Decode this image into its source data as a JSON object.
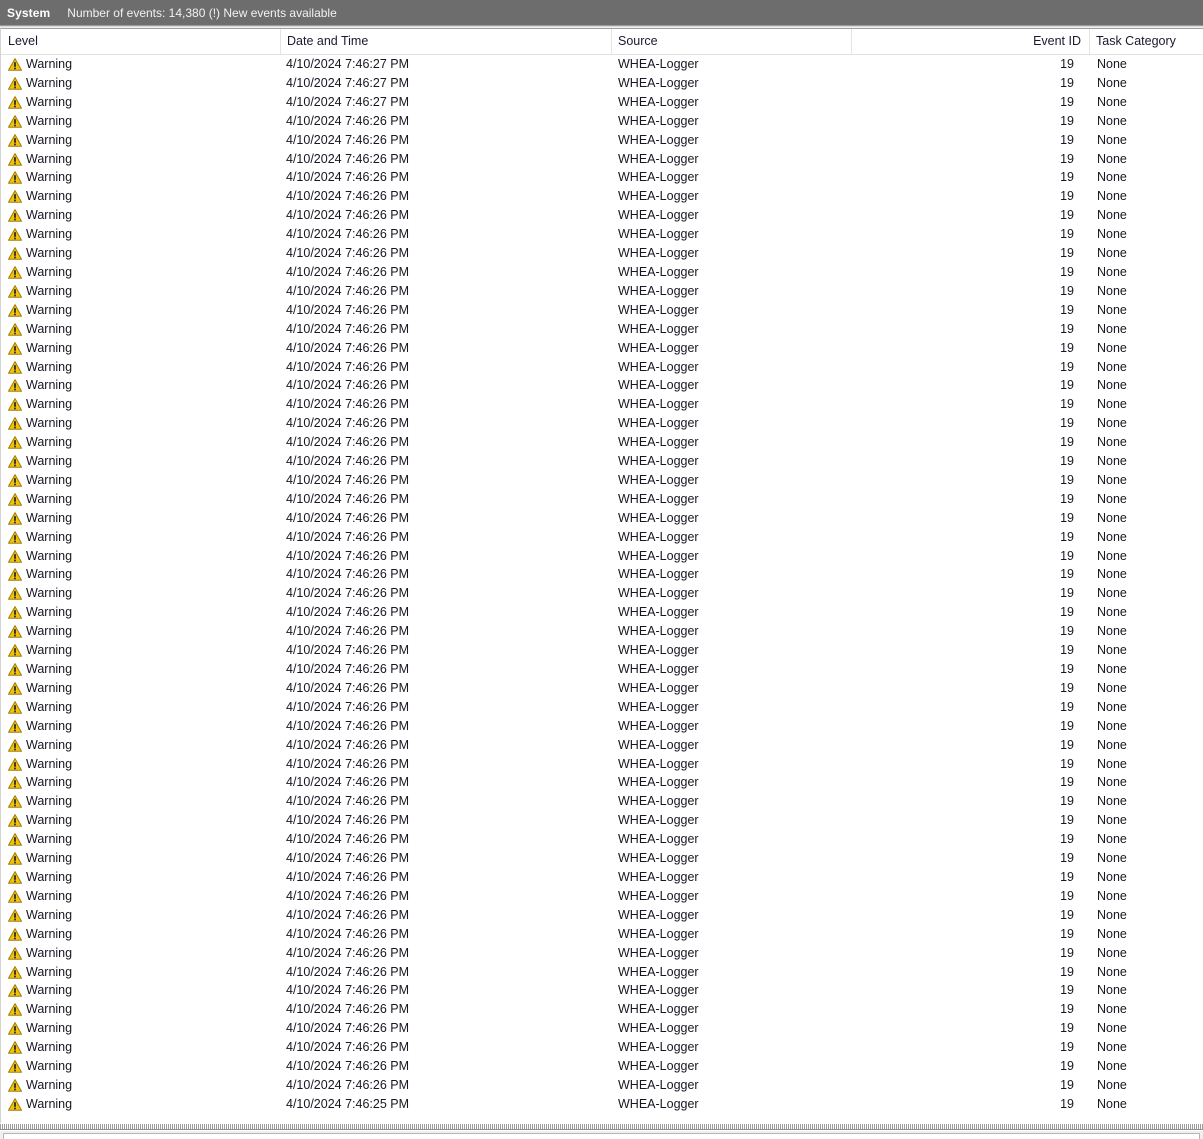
{
  "window": {
    "log_name": "System",
    "events_summary": "Number of events: 14,380 (!) New events available",
    "header_bg": "#6d6d6d"
  },
  "columns": [
    {
      "key": "level",
      "label": "Level",
      "align": "left"
    },
    {
      "key": "date",
      "label": "Date and Time",
      "align": "left"
    },
    {
      "key": "source",
      "label": "Source",
      "align": "left"
    },
    {
      "key": "eid",
      "label": "Event ID",
      "align": "right"
    },
    {
      "key": "task",
      "label": "Task Category",
      "align": "left"
    }
  ],
  "icons": {
    "warning": "warning-triangle-icon",
    "warning_fill": "#f2c209",
    "warning_stroke": "#a07e06",
    "warning_mark": "#2b2b2b"
  },
  "rows": [
    {
      "level": "Warning",
      "date": "4/10/2024 7:46:27 PM",
      "source": "WHEA-Logger",
      "eid": "19",
      "task": "None"
    },
    {
      "level": "Warning",
      "date": "4/10/2024 7:46:27 PM",
      "source": "WHEA-Logger",
      "eid": "19",
      "task": "None"
    },
    {
      "level": "Warning",
      "date": "4/10/2024 7:46:27 PM",
      "source": "WHEA-Logger",
      "eid": "19",
      "task": "None"
    },
    {
      "level": "Warning",
      "date": "4/10/2024 7:46:26 PM",
      "source": "WHEA-Logger",
      "eid": "19",
      "task": "None"
    },
    {
      "level": "Warning",
      "date": "4/10/2024 7:46:26 PM",
      "source": "WHEA-Logger",
      "eid": "19",
      "task": "None"
    },
    {
      "level": "Warning",
      "date": "4/10/2024 7:46:26 PM",
      "source": "WHEA-Logger",
      "eid": "19",
      "task": "None"
    },
    {
      "level": "Warning",
      "date": "4/10/2024 7:46:26 PM",
      "source": "WHEA-Logger",
      "eid": "19",
      "task": "None"
    },
    {
      "level": "Warning",
      "date": "4/10/2024 7:46:26 PM",
      "source": "WHEA-Logger",
      "eid": "19",
      "task": "None"
    },
    {
      "level": "Warning",
      "date": "4/10/2024 7:46:26 PM",
      "source": "WHEA-Logger",
      "eid": "19",
      "task": "None"
    },
    {
      "level": "Warning",
      "date": "4/10/2024 7:46:26 PM",
      "source": "WHEA-Logger",
      "eid": "19",
      "task": "None"
    },
    {
      "level": "Warning",
      "date": "4/10/2024 7:46:26 PM",
      "source": "WHEA-Logger",
      "eid": "19",
      "task": "None"
    },
    {
      "level": "Warning",
      "date": "4/10/2024 7:46:26 PM",
      "source": "WHEA-Logger",
      "eid": "19",
      "task": "None"
    },
    {
      "level": "Warning",
      "date": "4/10/2024 7:46:26 PM",
      "source": "WHEA-Logger",
      "eid": "19",
      "task": "None"
    },
    {
      "level": "Warning",
      "date": "4/10/2024 7:46:26 PM",
      "source": "WHEA-Logger",
      "eid": "19",
      "task": "None"
    },
    {
      "level": "Warning",
      "date": "4/10/2024 7:46:26 PM",
      "source": "WHEA-Logger",
      "eid": "19",
      "task": "None"
    },
    {
      "level": "Warning",
      "date": "4/10/2024 7:46:26 PM",
      "source": "WHEA-Logger",
      "eid": "19",
      "task": "None"
    },
    {
      "level": "Warning",
      "date": "4/10/2024 7:46:26 PM",
      "source": "WHEA-Logger",
      "eid": "19",
      "task": "None"
    },
    {
      "level": "Warning",
      "date": "4/10/2024 7:46:26 PM",
      "source": "WHEA-Logger",
      "eid": "19",
      "task": "None"
    },
    {
      "level": "Warning",
      "date": "4/10/2024 7:46:26 PM",
      "source": "WHEA-Logger",
      "eid": "19",
      "task": "None"
    },
    {
      "level": "Warning",
      "date": "4/10/2024 7:46:26 PM",
      "source": "WHEA-Logger",
      "eid": "19",
      "task": "None"
    },
    {
      "level": "Warning",
      "date": "4/10/2024 7:46:26 PM",
      "source": "WHEA-Logger",
      "eid": "19",
      "task": "None"
    },
    {
      "level": "Warning",
      "date": "4/10/2024 7:46:26 PM",
      "source": "WHEA-Logger",
      "eid": "19",
      "task": "None"
    },
    {
      "level": "Warning",
      "date": "4/10/2024 7:46:26 PM",
      "source": "WHEA-Logger",
      "eid": "19",
      "task": "None"
    },
    {
      "level": "Warning",
      "date": "4/10/2024 7:46:26 PM",
      "source": "WHEA-Logger",
      "eid": "19",
      "task": "None"
    },
    {
      "level": "Warning",
      "date": "4/10/2024 7:46:26 PM",
      "source": "WHEA-Logger",
      "eid": "19",
      "task": "None"
    },
    {
      "level": "Warning",
      "date": "4/10/2024 7:46:26 PM",
      "source": "WHEA-Logger",
      "eid": "19",
      "task": "None"
    },
    {
      "level": "Warning",
      "date": "4/10/2024 7:46:26 PM",
      "source": "WHEA-Logger",
      "eid": "19",
      "task": "None"
    },
    {
      "level": "Warning",
      "date": "4/10/2024 7:46:26 PM",
      "source": "WHEA-Logger",
      "eid": "19",
      "task": "None"
    },
    {
      "level": "Warning",
      "date": "4/10/2024 7:46:26 PM",
      "source": "WHEA-Logger",
      "eid": "19",
      "task": "None"
    },
    {
      "level": "Warning",
      "date": "4/10/2024 7:46:26 PM",
      "source": "WHEA-Logger",
      "eid": "19",
      "task": "None"
    },
    {
      "level": "Warning",
      "date": "4/10/2024 7:46:26 PM",
      "source": "WHEA-Logger",
      "eid": "19",
      "task": "None"
    },
    {
      "level": "Warning",
      "date": "4/10/2024 7:46:26 PM",
      "source": "WHEA-Logger",
      "eid": "19",
      "task": "None"
    },
    {
      "level": "Warning",
      "date": "4/10/2024 7:46:26 PM",
      "source": "WHEA-Logger",
      "eid": "19",
      "task": "None"
    },
    {
      "level": "Warning",
      "date": "4/10/2024 7:46:26 PM",
      "source": "WHEA-Logger",
      "eid": "19",
      "task": "None"
    },
    {
      "level": "Warning",
      "date": "4/10/2024 7:46:26 PM",
      "source": "WHEA-Logger",
      "eid": "19",
      "task": "None"
    },
    {
      "level": "Warning",
      "date": "4/10/2024 7:46:26 PM",
      "source": "WHEA-Logger",
      "eid": "19",
      "task": "None"
    },
    {
      "level": "Warning",
      "date": "4/10/2024 7:46:26 PM",
      "source": "WHEA-Logger",
      "eid": "19",
      "task": "None"
    },
    {
      "level": "Warning",
      "date": "4/10/2024 7:46:26 PM",
      "source": "WHEA-Logger",
      "eid": "19",
      "task": "None"
    },
    {
      "level": "Warning",
      "date": "4/10/2024 7:46:26 PM",
      "source": "WHEA-Logger",
      "eid": "19",
      "task": "None"
    },
    {
      "level": "Warning",
      "date": "4/10/2024 7:46:26 PM",
      "source": "WHEA-Logger",
      "eid": "19",
      "task": "None"
    },
    {
      "level": "Warning",
      "date": "4/10/2024 7:46:26 PM",
      "source": "WHEA-Logger",
      "eid": "19",
      "task": "None"
    },
    {
      "level": "Warning",
      "date": "4/10/2024 7:46:26 PM",
      "source": "WHEA-Logger",
      "eid": "19",
      "task": "None"
    },
    {
      "level": "Warning",
      "date": "4/10/2024 7:46:26 PM",
      "source": "WHEA-Logger",
      "eid": "19",
      "task": "None"
    },
    {
      "level": "Warning",
      "date": "4/10/2024 7:46:26 PM",
      "source": "WHEA-Logger",
      "eid": "19",
      "task": "None"
    },
    {
      "level": "Warning",
      "date": "4/10/2024 7:46:26 PM",
      "source": "WHEA-Logger",
      "eid": "19",
      "task": "None"
    },
    {
      "level": "Warning",
      "date": "4/10/2024 7:46:26 PM",
      "source": "WHEA-Logger",
      "eid": "19",
      "task": "None"
    },
    {
      "level": "Warning",
      "date": "4/10/2024 7:46:26 PM",
      "source": "WHEA-Logger",
      "eid": "19",
      "task": "None"
    },
    {
      "level": "Warning",
      "date": "4/10/2024 7:46:26 PM",
      "source": "WHEA-Logger",
      "eid": "19",
      "task": "None"
    },
    {
      "level": "Warning",
      "date": "4/10/2024 7:46:26 PM",
      "source": "WHEA-Logger",
      "eid": "19",
      "task": "None"
    },
    {
      "level": "Warning",
      "date": "4/10/2024 7:46:26 PM",
      "source": "WHEA-Logger",
      "eid": "19",
      "task": "None"
    },
    {
      "level": "Warning",
      "date": "4/10/2024 7:46:26 PM",
      "source": "WHEA-Logger",
      "eid": "19",
      "task": "None"
    },
    {
      "level": "Warning",
      "date": "4/10/2024 7:46:26 PM",
      "source": "WHEA-Logger",
      "eid": "19",
      "task": "None"
    },
    {
      "level": "Warning",
      "date": "4/10/2024 7:46:26 PM",
      "source": "WHEA-Logger",
      "eid": "19",
      "task": "None"
    },
    {
      "level": "Warning",
      "date": "4/10/2024 7:46:26 PM",
      "source": "WHEA-Logger",
      "eid": "19",
      "task": "None"
    },
    {
      "level": "Warning",
      "date": "4/10/2024 7:46:26 PM",
      "source": "WHEA-Logger",
      "eid": "19",
      "task": "None"
    },
    {
      "level": "Warning",
      "date": "4/10/2024 7:46:25 PM",
      "source": "WHEA-Logger",
      "eid": "19",
      "task": "None"
    }
  ]
}
